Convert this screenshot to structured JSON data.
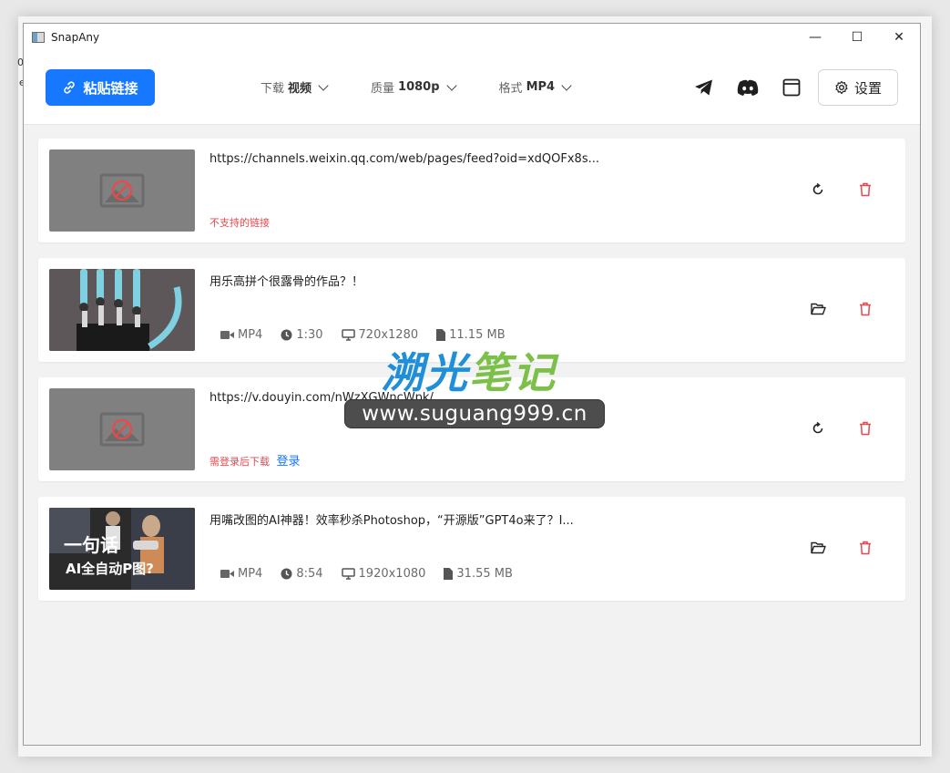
{
  "app": {
    "title": "SnapAny"
  },
  "window_controls": {
    "minimize": "—",
    "maximize": "☐",
    "close": "✕"
  },
  "toolbar": {
    "paste_label": "粘贴链接",
    "download": {
      "label": "下载",
      "value": "视频"
    },
    "quality": {
      "label": "质量",
      "value": "1080p"
    },
    "format": {
      "label": "格式",
      "value": "MP4"
    },
    "settings_label": "设置",
    "accent": "#1677ff"
  },
  "items": [
    {
      "title": "https://channels.weixin.qq.com/web/pages/feed?oid=xdQOFx8s...",
      "error": "不支持的链接",
      "action": "retry"
    },
    {
      "title": "用乐高拼个很露骨的作品？！",
      "meta": {
        "format": "MP4",
        "duration": "1:30",
        "resolution": "720x1280",
        "size": "11.15 MB"
      },
      "action": "open-folder"
    },
    {
      "title": "https://v.douyin.com/nWzXGWncWpk/",
      "error": "需登录后下载",
      "login_label": "登录",
      "action": "retry"
    },
    {
      "title": "用嘴改图的AI神器！效率秒杀Photoshop，“开源版”GPT4o来了？I...",
      "meta": {
        "format": "MP4",
        "duration": "8:54",
        "resolution": "1920x1080",
        "size": "31.55 MB"
      },
      "action": "open-folder",
      "thumb_text": {
        "line1": "一句话",
        "line2": "AI全自动P图?"
      }
    }
  ],
  "watermark": {
    "title_part1": "溯光",
    "title_part2": "笔记",
    "url": "www.suguang999.cn"
  },
  "edge": {
    "t1": "0",
    "t2": "ｅ"
  },
  "colors": {
    "error": "#e5484d",
    "delete": "#e5484d",
    "link": "#1677ff",
    "watermark_blue": "#1e8fd8",
    "watermark_green": "#7cc04a"
  }
}
